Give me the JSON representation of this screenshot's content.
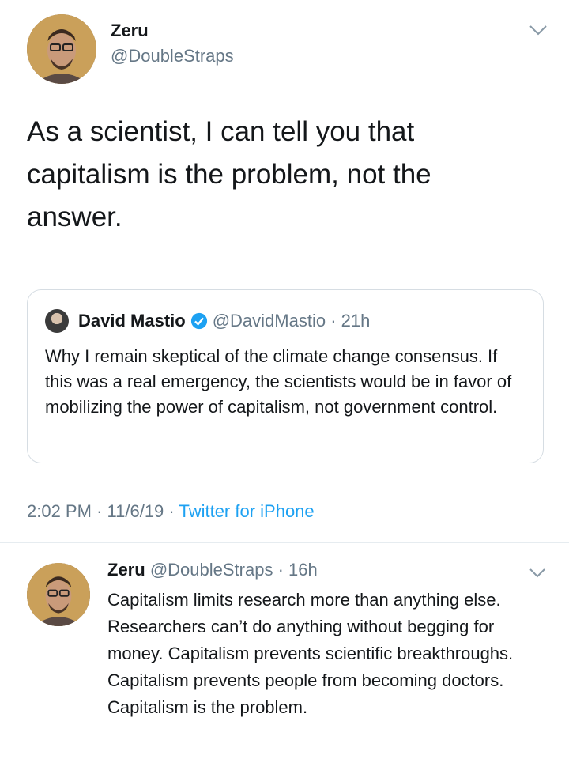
{
  "main_tweet": {
    "name": "Zeru",
    "handle": "@DoubleStraps",
    "avatar_icon": "profile-photo",
    "text": "As a scientist, I can tell you that capitalism is the problem, not the answer."
  },
  "quoted_tweet": {
    "name": "David Mastio",
    "verified_icon": "verified-badge-icon",
    "handle": "@DavidMastio",
    "separator": "·",
    "time": "21h",
    "text": "Why I remain skeptical of the climate change consensus. If this was a real emergency, the scientists would be in favor of mobilizing the power of capitalism, not government control."
  },
  "meta": {
    "time": "2:02 PM",
    "sep1": "·",
    "date": "11/6/19",
    "sep2": "·",
    "source": "Twitter for iPhone"
  },
  "reply": {
    "name": "Zeru",
    "handle": "@DoubleStraps",
    "separator": "·",
    "time": "16h",
    "text": "Capitalism limits research more than anything else. Researchers can’t do anything without begging for money. Capitalism prevents scientific breakthroughs. Capitalism prevents people from becoming doctors. Capitalism is the problem."
  },
  "colors": {
    "text": "#14171a",
    "secondary": "#657786",
    "link": "#1da1f2",
    "border": "#d6dde3"
  }
}
